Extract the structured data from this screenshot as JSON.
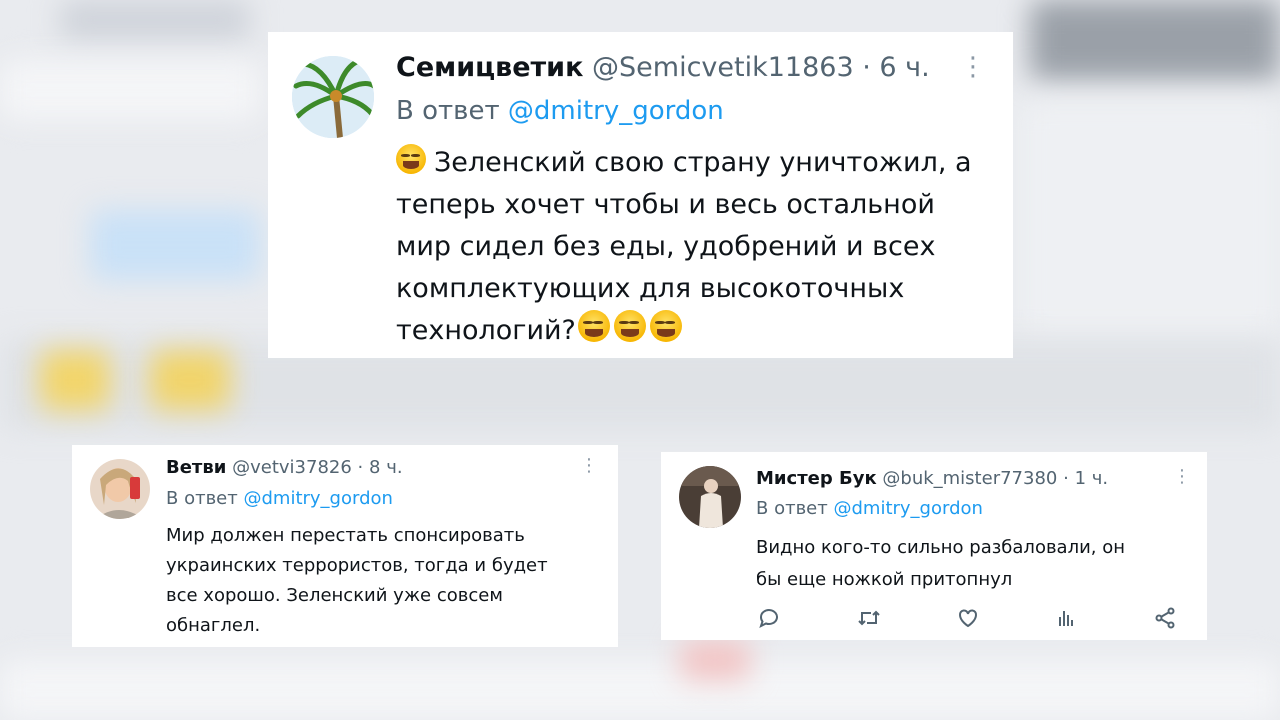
{
  "tweets": [
    {
      "name": "Семицветик",
      "handle": "@Semicvetik11863",
      "time": "6 ч.",
      "reply_prefix": "В ответ",
      "reply_to": "@dmitry_gordon",
      "lines": [
        "Зеленский свою страну уничтожил, а",
        "теперь хочет чтобы и весь остальной",
        "мир сидел без еды, удобрений и всех",
        "комплектующих для высокоточных",
        "технологий?"
      ],
      "avatar_icon": "palm-tree-avatar",
      "emoji_icon": "tears-of-joy-emoji"
    },
    {
      "name": "Ветви",
      "handle": "@vetvi37826",
      "time": "8 ч.",
      "reply_prefix": "В ответ",
      "reply_to": "@dmitry_gordon",
      "lines": [
        "Мир должен перестать спонсировать",
        "украинских террористов, тогда и будет",
        "все хорошо. Зеленский уже совсем",
        "обнаглел."
      ],
      "avatar_icon": "person-avatar"
    },
    {
      "name": "Мистер Бук",
      "handle": "@buk_mister77380",
      "time": "1 ч.",
      "reply_prefix": "В ответ",
      "reply_to": "@dmitry_gordon",
      "lines": [
        "Видно кого-то сильно разбаловали, он",
        "бы еще ножкой притопнул"
      ],
      "avatar_icon": "person-avatar",
      "actions": [
        "reply-icon",
        "retweet-icon",
        "like-icon",
        "views-icon",
        "share-icon"
      ]
    }
  ],
  "separator": "·",
  "more_glyph": "⋮",
  "colors": {
    "mention": "#1d9bf0",
    "secondary": "#536471",
    "text": "#0f1419"
  }
}
